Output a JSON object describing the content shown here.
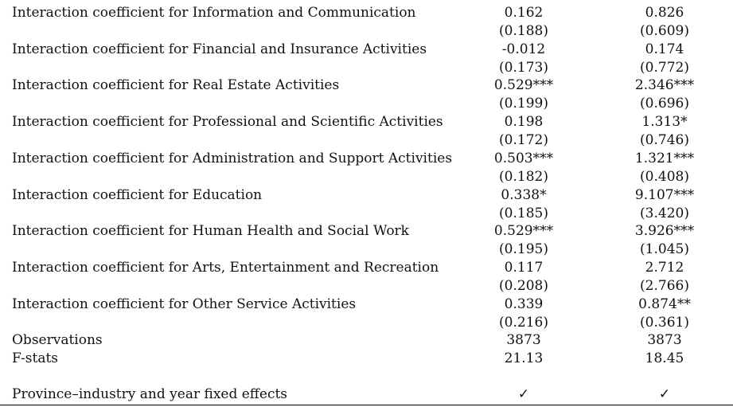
{
  "rows": [
    {
      "label": "Interaction coefficient for Information and Communication",
      "coef1": "0.162",
      "se1": "(0.188)",
      "coef2": "0.826",
      "se2": "(0.609)"
    },
    {
      "label": "Interaction coefficient for Financial and Insurance Activities",
      "coef1": "-0.012",
      "se1": "(0.173)",
      "coef2": "0.174",
      "se2": "(0.772)"
    },
    {
      "label": "Interaction coefficient for Real Estate Activities",
      "coef1": "0.529***",
      "se1": "(0.199)",
      "coef2": "2.346***",
      "se2": "(0.696)"
    },
    {
      "label": "Interaction coefficient for Professional and Scientific Activities",
      "coef1": "0.198",
      "se1": "(0.172)",
      "coef2": "1.313*",
      "se2": "(0.746)"
    },
    {
      "label": "Interaction coefficient for Administration and Support Activities",
      "coef1": "0.503***",
      "se1": "(0.182)",
      "coef2": "1.321***",
      "se2": "(0.408)"
    },
    {
      "label": "Interaction coefficient for Education",
      "coef1": "0.338*",
      "se1": "(0.185)",
      "coef2": "9.107***",
      "se2": "(3.420)"
    },
    {
      "label": "Interaction coefficient for Human Health and Social Work",
      "coef1": "0.529***",
      "se1": "(0.195)",
      "coef2": "3.926***",
      "se2": "(1.045)"
    },
    {
      "label": "Interaction coefficient for Arts, Entertainment and Recreation",
      "coef1": "0.117",
      "se1": "(0.208)",
      "coef2": "2.712",
      "se2": "(2.766)"
    },
    {
      "label": "Interaction coefficient for Other Service Activities",
      "coef1": "0.339",
      "se1": "(0.216)",
      "coef2": "0.874**",
      "se2": "(0.361)"
    }
  ],
  "stats": [
    {
      "label": "Observations",
      "v1": "3873",
      "v2": "3873"
    },
    {
      "label": "F-stats",
      "v1": "21.13",
      "v2": "18.45"
    }
  ],
  "fixed_effects": {
    "label": "Province–industry and year fixed effects",
    "v1": "✓",
    "v2": "✓"
  }
}
